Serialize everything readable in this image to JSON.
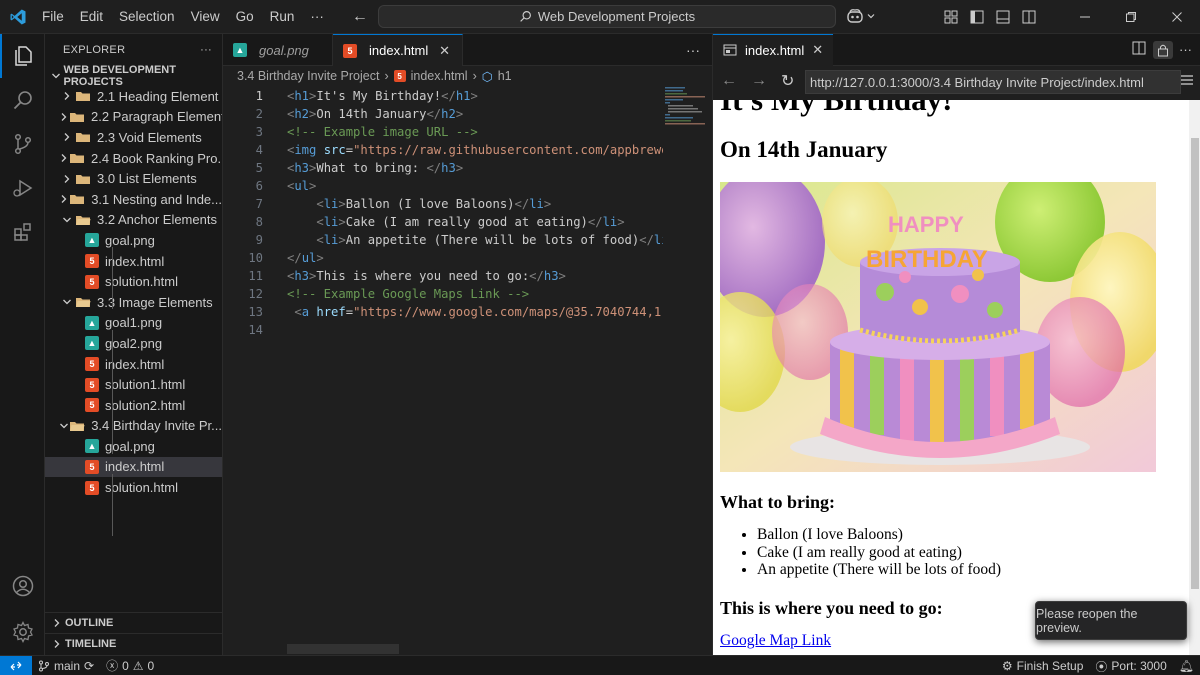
{
  "titlebar": {
    "menu": [
      "File",
      "Edit",
      "Selection",
      "View",
      "Go",
      "Run",
      "···"
    ],
    "search_text": "Web Development Projects"
  },
  "sidebar": {
    "title": "EXPLORER",
    "root": "WEB DEVELOPMENT PROJECTS",
    "tree": [
      {
        "label": "2.1 Heading Element",
        "type": "folder",
        "depth": 1,
        "expanded": false
      },
      {
        "label": "2.2 Paragraph Element",
        "type": "folder",
        "depth": 1,
        "expanded": false
      },
      {
        "label": "2.3 Void Elements",
        "type": "folder",
        "depth": 1,
        "expanded": false
      },
      {
        "label": "2.4 Book Ranking Pro...",
        "type": "folder",
        "depth": 1,
        "expanded": false
      },
      {
        "label": "3.0 List Elements",
        "type": "folder",
        "depth": 1,
        "expanded": false
      },
      {
        "label": "3.1 Nesting and Inde...",
        "type": "folder",
        "depth": 1,
        "expanded": false
      },
      {
        "label": "3.2 Anchor Elements",
        "type": "folder",
        "depth": 1,
        "expanded": true
      },
      {
        "label": "goal.png",
        "type": "png",
        "depth": 2
      },
      {
        "label": "index.html",
        "type": "html",
        "depth": 2
      },
      {
        "label": "solution.html",
        "type": "html",
        "depth": 2
      },
      {
        "label": "3.3 Image Elements",
        "type": "folder",
        "depth": 1,
        "expanded": true
      },
      {
        "label": "goal1.png",
        "type": "png",
        "depth": 2
      },
      {
        "label": "goal2.png",
        "type": "png",
        "depth": 2
      },
      {
        "label": "index.html",
        "type": "html",
        "depth": 2
      },
      {
        "label": "solution1.html",
        "type": "html",
        "depth": 2
      },
      {
        "label": "solution2.html",
        "type": "html",
        "depth": 2
      },
      {
        "label": "3.4 Birthday Invite Pr...",
        "type": "folder",
        "depth": 1,
        "expanded": true
      },
      {
        "label": "goal.png",
        "type": "png",
        "depth": 2
      },
      {
        "label": "index.html",
        "type": "html",
        "depth": 2,
        "selected": true
      },
      {
        "label": "solution.html",
        "type": "html",
        "depth": 2
      }
    ],
    "outline": "OUTLINE",
    "timeline": "TIMELINE"
  },
  "editor": {
    "tabs": [
      {
        "label": "goal.png",
        "active": false
      },
      {
        "label": "index.html",
        "active": true
      }
    ],
    "breadcrumb": [
      "3.4 Birthday Invite Project",
      "index.html",
      "h1"
    ],
    "current_line": 1,
    "lines": [
      {
        "n": "1",
        "text": "<h1>It's My Birthday!</h1>"
      },
      {
        "n": "2",
        "text": "<h2>On 14th January</h2>"
      },
      {
        "n": "3",
        "text": "<!-- Example image URL -->"
      },
      {
        "n": "4",
        "text": "<img src=\"https://raw.githubusercontent.com/appbrewe"
      },
      {
        "n": "5",
        "text": "<h3>What to bring: </h3>"
      },
      {
        "n": "6",
        "text": "<ul>"
      },
      {
        "n": "7",
        "text": "    <li>Ballon (I love Baloons)</li>"
      },
      {
        "n": "8",
        "text": "    <li>Cake (I am really good at eating)</li>"
      },
      {
        "n": "9",
        "text": "    <li>An appetite (There will be lots of food)</li"
      },
      {
        "n": "10",
        "text": "</ul>"
      },
      {
        "n": "11",
        "text": "<h3>This is where you need to go:</h3>"
      },
      {
        "n": "12",
        "text": "<!-- Example Google Maps Link -->"
      },
      {
        "n": "13",
        "text": " <a href=\"https://www.google.com/maps/@35.7040744,1"
      },
      {
        "n": "14",
        "text": ""
      }
    ]
  },
  "preview": {
    "tab_label": "index.html",
    "url": "http://127.0.0.1:3000/3.4 Birthday Invite Project/index.html",
    "page": {
      "h1": "It's My Birthday!",
      "h2": "On 14th January",
      "h3_bring": "What to bring:",
      "items": [
        "Ballon (I love Baloons)",
        "Cake (I am really good at eating)",
        "An appetite (There will be lots of food)"
      ],
      "h3_where": "This is where you need to go:",
      "link": "Google Map Link",
      "cake_topper_1": "HAPPY",
      "cake_topper_2": "BIRTHDAY"
    },
    "toast": "Please reopen the preview."
  },
  "statusbar": {
    "branch": "main",
    "errors": "0",
    "warnings": "0",
    "finish_setup": "Finish Setup",
    "port": "Port: 3000"
  },
  "colors": {
    "accent": "#0078d4",
    "html_icon": "#e34c26",
    "png_icon": "#26a69a"
  }
}
